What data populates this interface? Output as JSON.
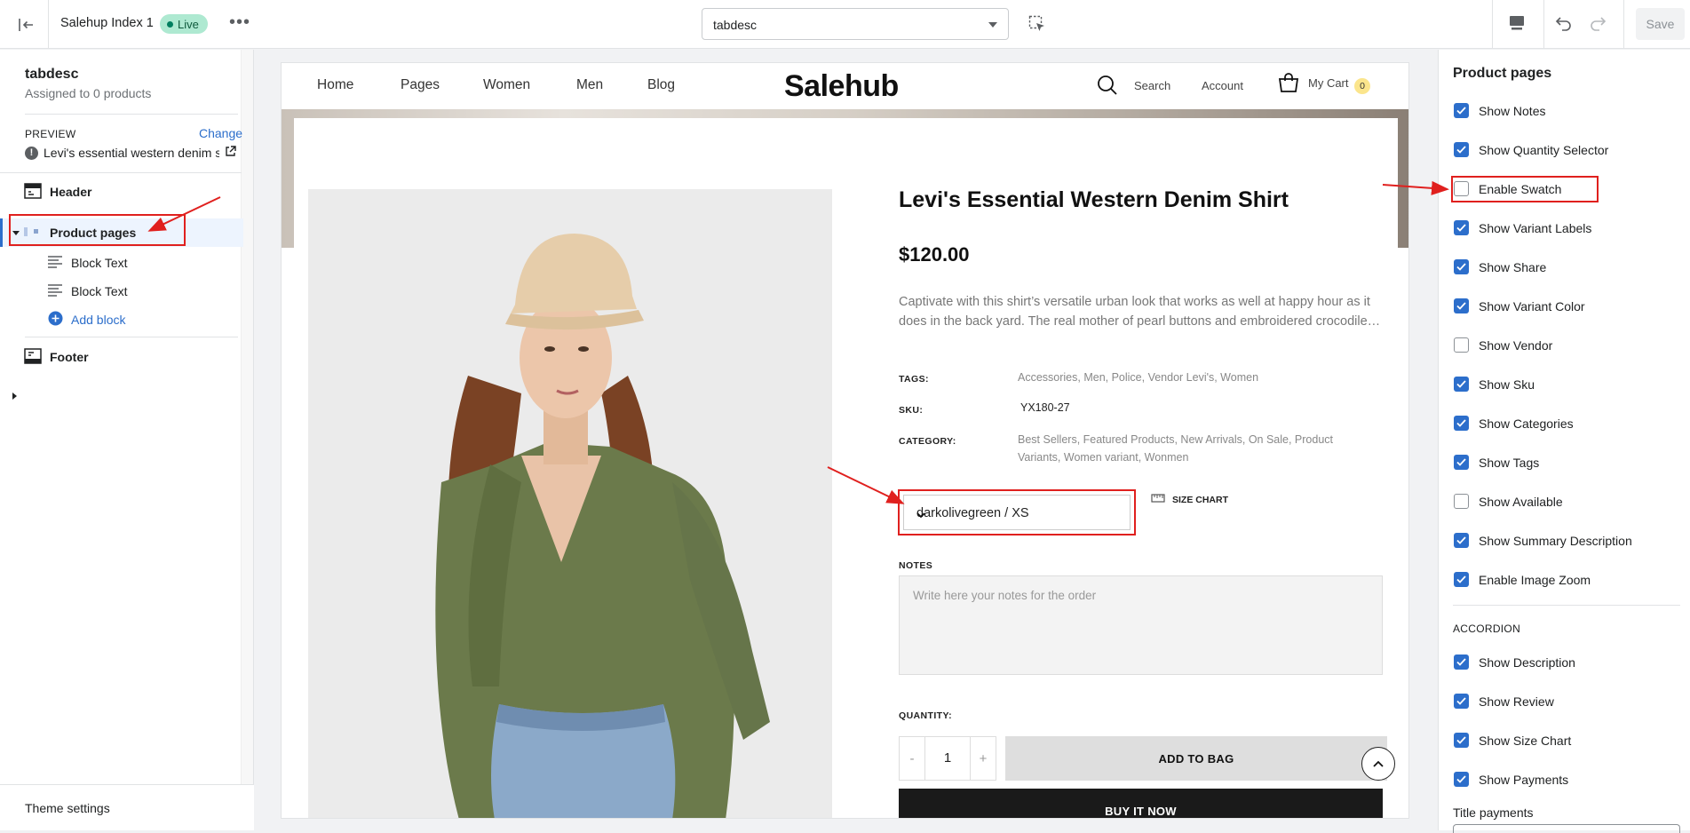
{
  "topbar": {
    "theme_name": "Salehup Index 1",
    "live_badge": "Live",
    "more": "•••",
    "template_select": "tabdesc",
    "save_label": "Save"
  },
  "left_panel": {
    "title": "tabdesc",
    "subtitle": "Assigned to 0 products",
    "preview_label": "PREVIEW",
    "change_label": "Change",
    "preview_product": "Levi's essential western denim shirt",
    "sections": [
      {
        "label": "Header"
      },
      {
        "label": "Product pages"
      },
      {
        "label": "Block Text"
      },
      {
        "label": "Block Text"
      },
      {
        "label": "Add block"
      },
      {
        "label": "Footer"
      }
    ],
    "theme_settings": "Theme settings"
  },
  "store": {
    "nav": [
      "Home",
      "Pages",
      "Women",
      "Men",
      "Blog"
    ],
    "logo": "Salehub",
    "search": "Search",
    "account": "Account",
    "cart": "My Cart",
    "cart_count": "0"
  },
  "product": {
    "title": "Levi's Essential Western Denim Shirt",
    "price": "$120.00",
    "description": "Captivate with this shirt’s versatile urban look that works as well at happy hour as it does in the back yard. The real mother of pearl buttons and embroidered crocodile…",
    "tags_label": "TAGS:",
    "tags_value": "Accessories, Men, Police, Vendor Levi's, Women",
    "sku_label": "SKU:",
    "sku_value": "YX180-27",
    "category_label": "CATEGORY:",
    "category_value": "Best Sellers, Featured Products, New Arrivals, On Sale, Product Variants, Women variant, Wonmen",
    "variant": "darkolivegreen / XS",
    "size_chart": "SIZE CHART",
    "notes_label": "NOTES",
    "notes_placeholder": "Write here your notes for the order",
    "quantity_label": "QUANTITY:",
    "qty_minus": "-",
    "quantity": "1",
    "qty_plus": "+",
    "add_to_bag": "ADD TO BAG",
    "buy_now": "BUY IT NOW"
  },
  "right_panel": {
    "title": "Product pages",
    "options": [
      {
        "label": "Show Notes",
        "checked": true
      },
      {
        "label": "Show Quantity Selector",
        "checked": true
      },
      {
        "label": "Enable Swatch",
        "checked": false
      },
      {
        "label": "Show Variant Labels",
        "checked": true
      },
      {
        "label": "Show Share",
        "checked": true
      },
      {
        "label": "Show Variant Color",
        "checked": true
      },
      {
        "label": "Show Vendor",
        "checked": false
      },
      {
        "label": "Show Sku",
        "checked": true
      },
      {
        "label": "Show Categories",
        "checked": true
      },
      {
        "label": "Show Tags",
        "checked": true
      },
      {
        "label": "Show Available",
        "checked": false
      },
      {
        "label": "Show Summary Description",
        "checked": true
      },
      {
        "label": "Enable Image Zoom",
        "checked": true
      }
    ],
    "accordion_label": "ACCORDION",
    "accordion_options": [
      {
        "label": "Show Description",
        "checked": true
      },
      {
        "label": "Show Review",
        "checked": true
      },
      {
        "label": "Show Size Chart",
        "checked": true
      },
      {
        "label": "Show Payments",
        "checked": true
      }
    ],
    "title_payments": "Title payments"
  },
  "colors": {
    "accent": "#2c6ecb",
    "highlight": "#e0201e",
    "live": "#aee9d1"
  }
}
